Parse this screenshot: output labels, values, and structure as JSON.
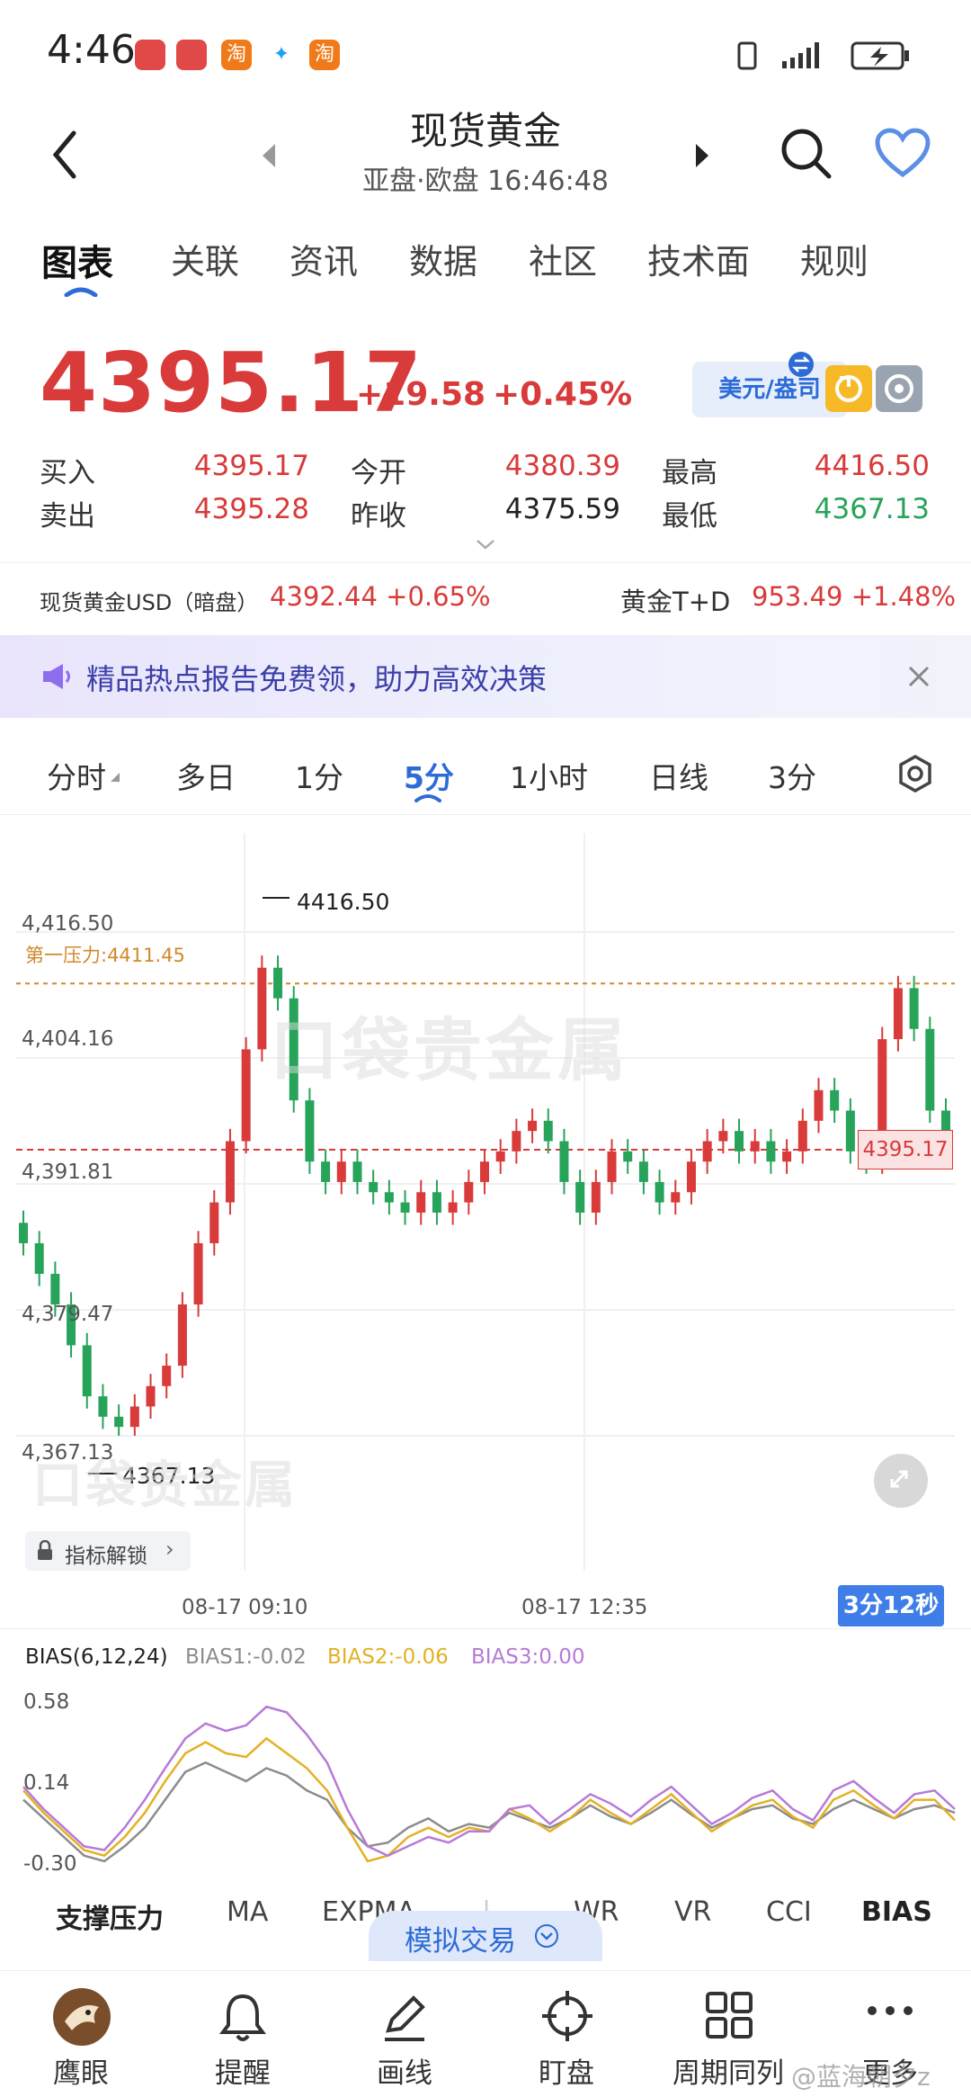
{
  "status_bar": {
    "time": "4:46"
  },
  "header": {
    "title": "现货黄金",
    "subtitle": "亚盘·欧盘  16:46:48"
  },
  "tabs": [
    "图表",
    "关联",
    "资讯",
    "数据",
    "社区",
    "技术面",
    "规则"
  ],
  "quote": {
    "price": "4395.17",
    "change": "+19.58",
    "change_pct": "+0.45%",
    "currency_btn": "美元/盎司",
    "rows": [
      {
        "l1": "买入",
        "v1": "4395.17",
        "l2": "今开",
        "v2": "4380.39",
        "l3": "最高",
        "v3": "4416.50"
      },
      {
        "l1": "卖出",
        "v1": "4395.28",
        "l2": "昨收",
        "v2": "4375.59",
        "l3": "最低",
        "v3": "4367.13"
      }
    ]
  },
  "dark_market": {
    "label": "现货黄金USD（暗盘）",
    "value": "4392.44 +0.65%",
    "td_label": "黄金T+D",
    "td_value": "953.49 +1.48%"
  },
  "banner": {
    "text": "精品热点报告免费领，助力高效决策"
  },
  "periods": [
    "分时",
    "多日",
    "1分",
    "5分",
    "1小时",
    "日线",
    "3分"
  ],
  "chart": {
    "y_labels": [
      "4,416.50",
      "4,404.16",
      "4,391.81",
      "4,379.47",
      "4,367.13"
    ],
    "resistance_label": "第一压力:4411.45",
    "high_marker": "4416.50",
    "low_marker": "4367.13",
    "current_tag": "4395.17",
    "x_labels": [
      "08-17 09:10",
      "08-17 12:35"
    ],
    "countdown": "3分12秒",
    "watermark": "口袋贵金属",
    "unlock_btn": "指标解锁",
    "colors": {
      "up": "#d93a3a",
      "down": "#27a35a"
    }
  },
  "chart_data": {
    "type": "candlestick",
    "ylim": [
      4367.13,
      4416.5
    ],
    "resistance": 4411.45,
    "current": 4395.17,
    "close_series": [
      4386,
      4383,
      4380,
      4376,
      4371,
      4369,
      4368,
      4370,
      4372,
      4374,
      4380,
      4386,
      4390,
      4396,
      4405,
      4413,
      4410,
      4400,
      4394,
      4392,
      4394,
      4392,
      4391,
      4390,
      4389,
      4391,
      4389,
      4390,
      4392,
      4394,
      4395,
      4397,
      4398,
      4396,
      4392,
      4389,
      4392,
      4395,
      4394,
      4392,
      4390,
      4391,
      4394,
      4396,
      4397,
      4395,
      4396,
      4394,
      4395,
      4398,
      4401,
      4399,
      4395,
      4394,
      4406,
      4411,
      4407,
      4399,
      4396
    ]
  },
  "bias": {
    "title": "BIAS(6,12,24)",
    "bias1": "BIAS1:-0.02",
    "bias2": "BIAS2:-0.06",
    "bias3": "BIAS3:0.00",
    "y_labels": [
      "0.58",
      "0.14",
      "-0.30"
    ],
    "series": {
      "bias1": [
        0.05,
        -0.05,
        -0.15,
        -0.25,
        -0.28,
        -0.2,
        -0.1,
        0.05,
        0.2,
        0.25,
        0.2,
        0.15,
        0.22,
        0.18,
        0.1,
        0.05,
        -0.1,
        -0.2,
        -0.18,
        -0.1,
        -0.05,
        -0.12,
        -0.08,
        -0.1,
        -0.02,
        -0.06,
        -0.1,
        -0.05,
        0.02,
        -0.04,
        -0.08,
        -0.02,
        0.05,
        -0.03,
        -0.1,
        -0.05,
        0.0,
        0.02,
        -0.05,
        -0.08,
        0.0,
        0.05,
        0.0,
        -0.05,
        0.0,
        0.02,
        -0.02
      ],
      "bias2": [
        0.1,
        -0.02,
        -0.12,
        -0.22,
        -0.25,
        -0.15,
        -0.02,
        0.15,
        0.3,
        0.36,
        0.3,
        0.28,
        0.38,
        0.3,
        0.22,
        0.1,
        -0.1,
        -0.28,
        -0.25,
        -0.15,
        -0.1,
        -0.15,
        -0.1,
        -0.12,
        0.0,
        -0.05,
        -0.12,
        -0.05,
        0.05,
        -0.02,
        -0.08,
        0.0,
        0.08,
        -0.02,
        -0.12,
        -0.05,
        0.02,
        0.05,
        -0.04,
        -0.1,
        0.05,
        0.1,
        0.02,
        -0.05,
        0.05,
        0.05,
        -0.06
      ],
      "bias3": [
        0.12,
        0.0,
        -0.1,
        -0.2,
        -0.22,
        -0.1,
        0.05,
        0.22,
        0.38,
        0.46,
        0.42,
        0.45,
        0.55,
        0.52,
        0.4,
        0.25,
        0.0,
        -0.2,
        -0.25,
        -0.2,
        -0.15,
        -0.18,
        -0.12,
        -0.12,
        0.0,
        0.02,
        -0.08,
        0.0,
        0.08,
        0.03,
        -0.04,
        0.05,
        0.12,
        0.02,
        -0.08,
        -0.02,
        0.06,
        0.1,
        0.0,
        -0.06,
        0.1,
        0.15,
        0.06,
        -0.02,
        0.08,
        0.1,
        0.0
      ]
    },
    "colors": {
      "bias1": "#8c8c8c",
      "bias2": "#e3b125",
      "bias3": "#b77ad6"
    }
  },
  "indicator_tabs": [
    "支撑压力",
    "MA",
    "EXPMA",
    "|",
    "WR",
    "VR",
    "CCI",
    "BIAS"
  ],
  "sim_trade": "模拟交易",
  "bottom_nav": [
    "鹰眼",
    "提醒",
    "画线",
    "盯盘",
    "周期同列",
    "更多"
  ],
  "watermark_user": "@蓝海朝夕z"
}
